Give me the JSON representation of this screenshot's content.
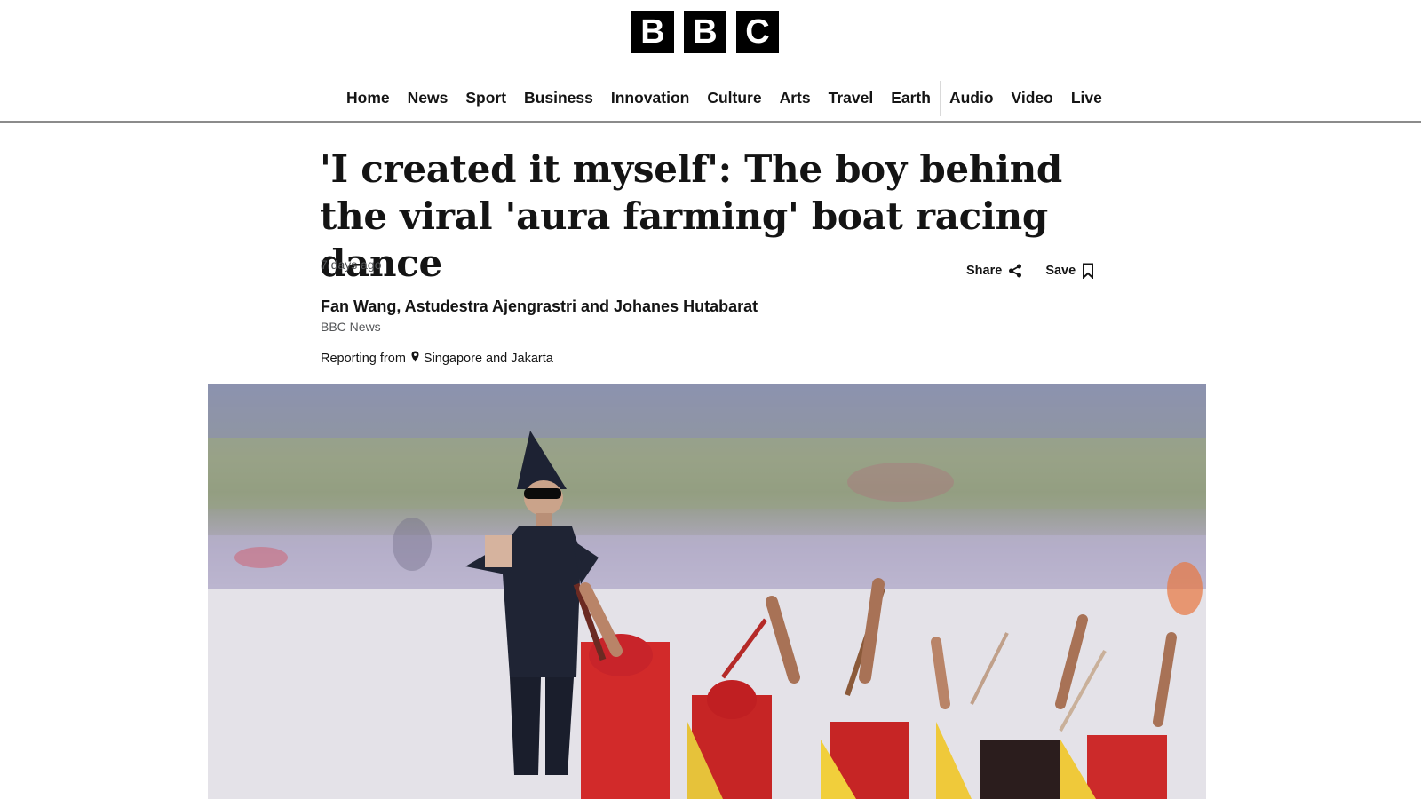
{
  "brand": {
    "letters": [
      "B",
      "B",
      "C"
    ]
  },
  "nav": {
    "primary": [
      "Home",
      "News",
      "Sport",
      "Business",
      "Innovation",
      "Culture",
      "Arts",
      "Travel",
      "Earth"
    ],
    "secondary": [
      "Audio",
      "Video",
      "Live"
    ]
  },
  "article": {
    "headline": "'I created it myself': The boy behind the viral 'aura farming' boat racing dance",
    "timestamp": "7 days ago",
    "share_label": "Share",
    "save_label": "Save",
    "authors": "Fan Wang, Astudestra Ajengrastri and Johanes Hutabarat",
    "outlet": "BBC News",
    "reporting_prefix": "Reporting from",
    "location": "Singapore and Jakarta"
  },
  "colors": {
    "text": "#141414",
    "muted": "#545658",
    "brand_black": "#000000",
    "nav_rule": "#8b8b8b"
  },
  "icons": {
    "share": "share-icon",
    "save": "bookmark-icon",
    "location": "location-pin-icon"
  }
}
